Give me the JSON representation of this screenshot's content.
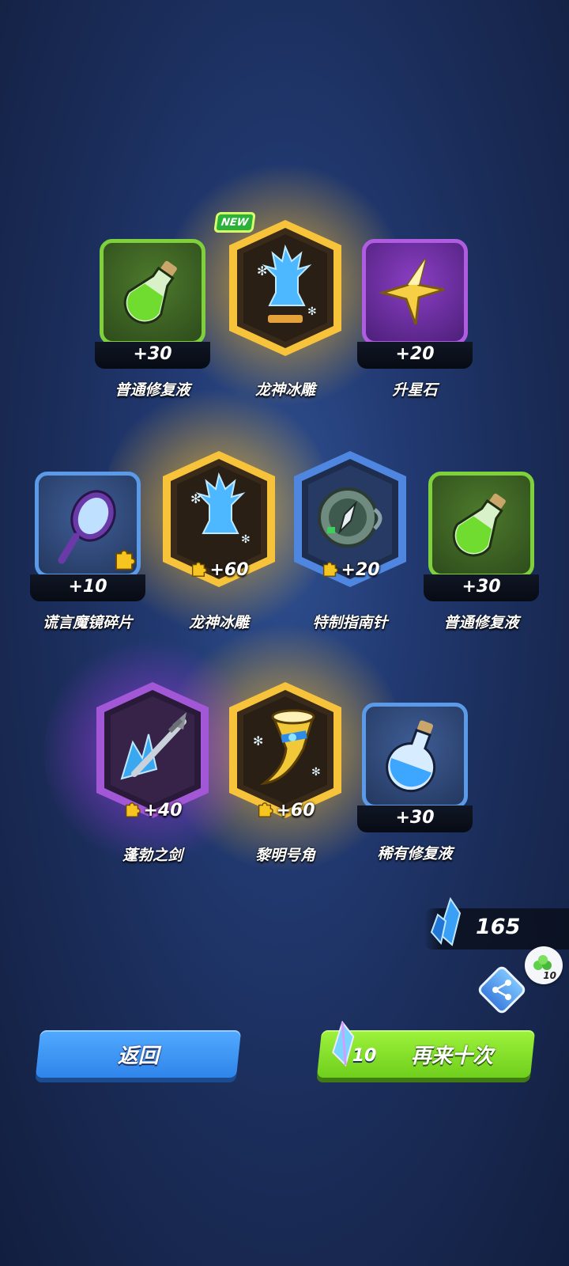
{
  "rewards": [
    {
      "name": "普通修复液",
      "count": "+30",
      "rarity": "green",
      "icon": "green-potion-icon",
      "new": false,
      "fragment": false
    },
    {
      "name": "龙神冰雕",
      "count": "",
      "rarity": "gold",
      "icon": "dragon-ice-statue-icon",
      "new": true,
      "new_label": "NEW",
      "fragment": false
    },
    {
      "name": "升星石",
      "count": "+20",
      "rarity": "purple",
      "icon": "star-stone-icon",
      "new": false,
      "fragment": false
    },
    {
      "name": "谎言魔镜碎片",
      "count": "+10",
      "rarity": "blue",
      "icon": "magic-mirror-icon",
      "new": false,
      "fragment": true
    },
    {
      "name": "龙神冰雕",
      "count": "+60",
      "rarity": "gold",
      "icon": "dragon-ice-statue-icon",
      "new": false,
      "fragment": true
    },
    {
      "name": "特制指南针",
      "count": "+20",
      "rarity": "blue",
      "icon": "compass-icon",
      "new": false,
      "fragment": true
    },
    {
      "name": "普通修复液",
      "count": "+30",
      "rarity": "green",
      "icon": "green-potion-icon",
      "new": false,
      "fragment": false
    },
    {
      "name": "蓬勃之剑",
      "count": "+40",
      "rarity": "purple",
      "icon": "crystal-sword-icon",
      "new": false,
      "fragment": true
    },
    {
      "name": "黎明号角",
      "count": "+60",
      "rarity": "gold",
      "icon": "dawn-horn-icon",
      "new": false,
      "fragment": true
    },
    {
      "name": "稀有修复液",
      "count": "+30",
      "rarity": "blue",
      "icon": "blue-potion-icon",
      "new": false,
      "fragment": false
    }
  ],
  "currency": {
    "icon": "blue-crystal-icon",
    "amount": "165"
  },
  "share": {
    "icon": "share-icon",
    "bubble_icon": "green-gem-pile-icon",
    "bubble_count": "10"
  },
  "buttons": {
    "back_label": "返回",
    "again_label": "再来十次",
    "again_cost": "10",
    "again_cost_icon": "rainbow-crystal-icon"
  },
  "colors": {
    "gold": "#f2b01e",
    "purple": "#b05ce0",
    "blue": "#5a9ae8",
    "green": "#7ed13b",
    "back_button": "#3f95f5",
    "again_button": "#86e22c"
  }
}
